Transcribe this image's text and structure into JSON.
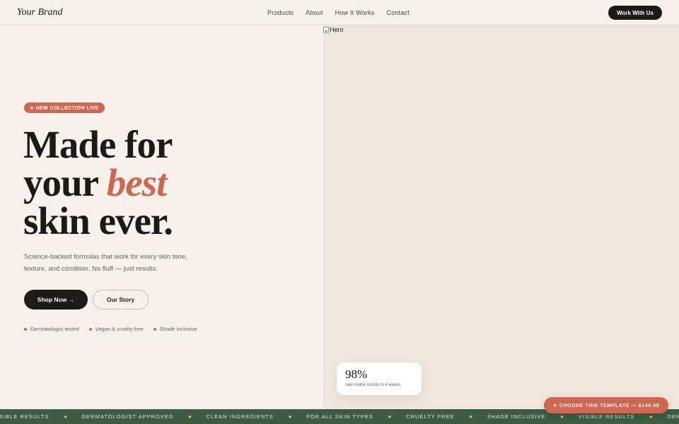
{
  "nav": {
    "brand": "Your Brand",
    "links": [
      "Products",
      "About",
      "How It Works",
      "Contact"
    ],
    "cta": "Work With Us"
  },
  "hero": {
    "image_alt": "Hero",
    "badge": "✦ NEW COLLECTION LIVE",
    "headline_line1": "Made for",
    "headline_line2_plain": "your ",
    "headline_line2_accent": "best",
    "headline_line3": "skin ever.",
    "subtitle": "Science-backed formulas that work for every skin tone, texture, and condition. No fluff — just results.",
    "primary_button": "Shop Now →",
    "secondary_button": "Our Story",
    "features": [
      "Dermatologist tested",
      "Vegan & cruelty-free",
      "Shade inclusive"
    ]
  },
  "stat": {
    "value": "98%",
    "caption": "saw visible results in 4 weeks"
  },
  "ticker": {
    "items": [
      "VISIBLE RESULTS",
      "DERMATOLOGIST APPROVED",
      "CLEAN INGREDIENTS",
      "FOR ALL SKIN TYPES",
      "CRUELTY FREE",
      "SHADE INCLUSIVE",
      "VISIBLE RESULTS",
      "DERMATOLOGIST APPROVED"
    ],
    "separator": "★"
  },
  "floating_cta": "✦ CHOOSE THIS TEMPLATE — $149.99",
  "colors": {
    "background": "#f6f1ea",
    "accent": "#cf6652",
    "dark": "#1c1a17",
    "ticker_bg": "#3d5c43"
  }
}
